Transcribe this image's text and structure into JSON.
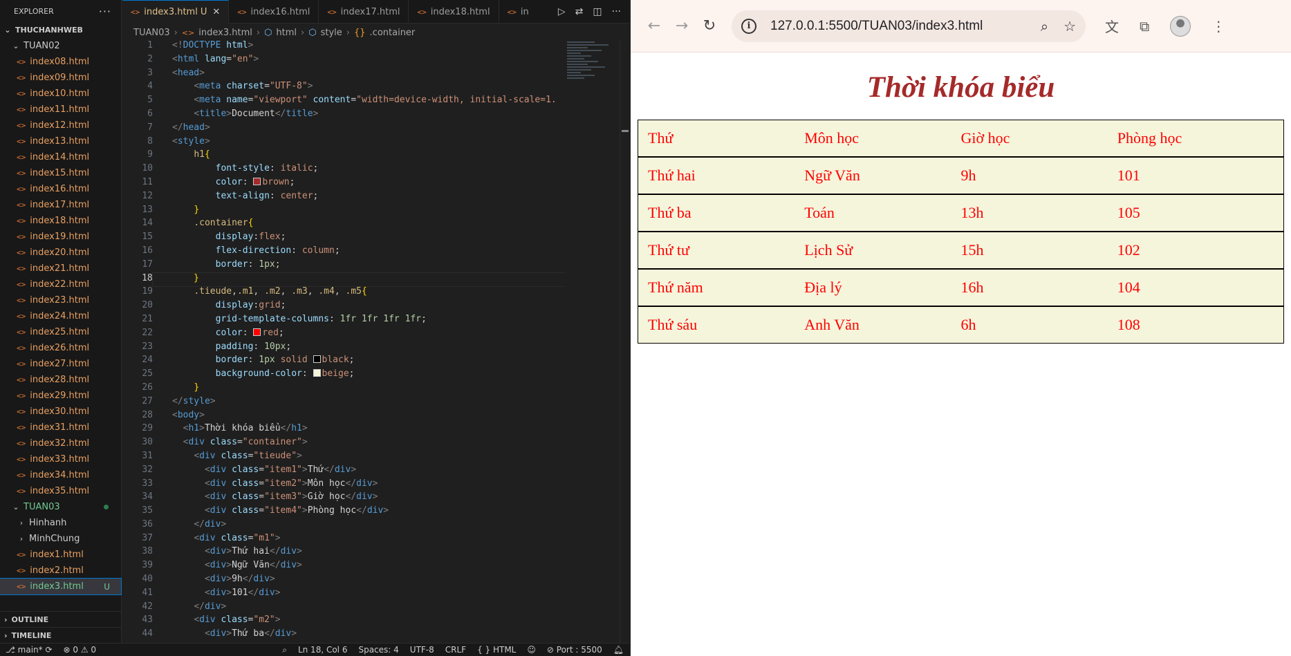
{
  "vscode": {
    "explorer_label": "EXPLORER",
    "workspace": "THUCHANHWEB",
    "folder_tuan02": "TUAN02",
    "tuan02_files": [
      "index08.html",
      "index09.html",
      "index10.html",
      "index11.html",
      "index12.html",
      "index13.html",
      "index14.html",
      "index15.html",
      "index16.html",
      "index17.html",
      "index18.html",
      "index19.html",
      "index20.html",
      "index21.html",
      "index22.html",
      "index23.html",
      "index24.html",
      "index25.html",
      "index26.html",
      "index27.html",
      "index28.html",
      "index29.html",
      "index30.html",
      "index31.html",
      "index32.html",
      "index33.html",
      "index34.html",
      "index35.html"
    ],
    "folder_tuan03": "TUAN03",
    "tuan03_subfolders": [
      "Hinhanh",
      "MinhChung"
    ],
    "tuan03_files": [
      "index1.html",
      "index2.html"
    ],
    "active_file": "index3.html",
    "active_badge": "U",
    "outline": "OUTLINE",
    "timeline": "TIMELINE",
    "tabs": [
      {
        "label": "index3.html",
        "badge": "U"
      },
      {
        "label": "index16.html"
      },
      {
        "label": "index17.html"
      },
      {
        "label": "index18.html"
      },
      {
        "label": "in"
      }
    ],
    "breadcrumb": [
      "TUAN03",
      "index3.html",
      "html",
      "style",
      ".container"
    ],
    "status": {
      "branch": "main*",
      "problems": "⊗ 0 ⚠ 0",
      "position": "Ln 18, Col 6",
      "spaces": "Spaces: 4",
      "encoding": "UTF-8",
      "eol": "CRLF",
      "language": "{ } HTML",
      "port": "⊘ Port : 5500"
    }
  },
  "browser": {
    "url": "127.0.0.1:5500/TUAN03/index3.html",
    "page_title": "Thời khóa biểu",
    "headers": [
      "Thứ",
      "Môn học",
      "Giờ học",
      "Phòng học"
    ],
    "rows": [
      [
        "Thứ hai",
        "Ngữ Văn",
        "9h",
        "101"
      ],
      [
        "Thứ ba",
        "Toán",
        "13h",
        "105"
      ],
      [
        "Thứ tư",
        "Lịch Sử",
        "15h",
        "102"
      ],
      [
        "Thứ năm",
        "Địa lý",
        "16h",
        "104"
      ],
      [
        "Thứ sáu",
        "Anh Văn",
        "6h",
        "108"
      ]
    ]
  }
}
